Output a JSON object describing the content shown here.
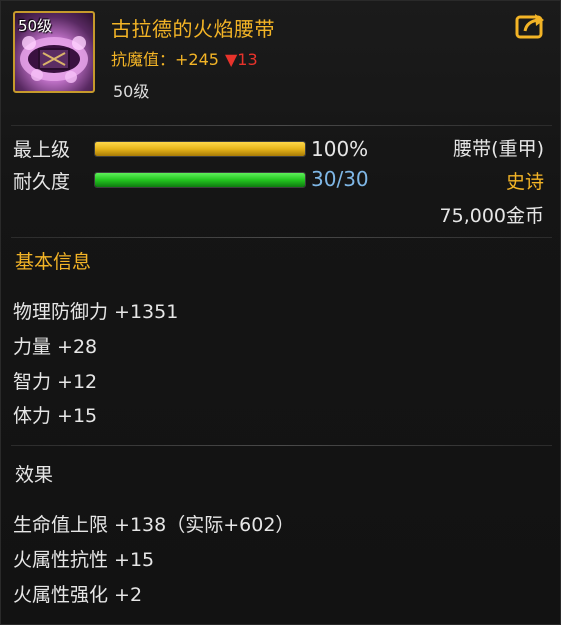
{
  "item": {
    "icon": "flame-belt-icon",
    "icon_level": "50级",
    "name": "古拉德的火焰腰带",
    "stat_label": "抗魔值：",
    "stat_value": "+245",
    "stat_diff": "▼13",
    "level": "50级",
    "share_icon": "share-export-icon"
  },
  "progress": {
    "upgrade": {
      "label": "最上级",
      "value_text": "100%",
      "fraction": 1.0
    },
    "durability": {
      "label": "耐久度",
      "value_text": "30/30",
      "fraction": 1.0
    }
  },
  "meta": {
    "type": "腰带(重甲)",
    "rarity": "史诗",
    "price": "75,000金币"
  },
  "sections": {
    "basic": {
      "title": "基本信息",
      "stats": [
        "物理防御力 +1351",
        "力量 +28",
        "智力 +12",
        "体力 +15"
      ]
    },
    "effects": {
      "title": "效果",
      "stats": [
        "生命值上限 +138（实际+602）",
        "火属性抗性 +15",
        "火属性强化 +2"
      ]
    }
  },
  "colors": {
    "gold_text": "#f3b426",
    "rarity": "#f3b426",
    "durability_text": "#7fb7e6",
    "down_arrow": "#e8332b",
    "frame": "#c69a2c"
  }
}
